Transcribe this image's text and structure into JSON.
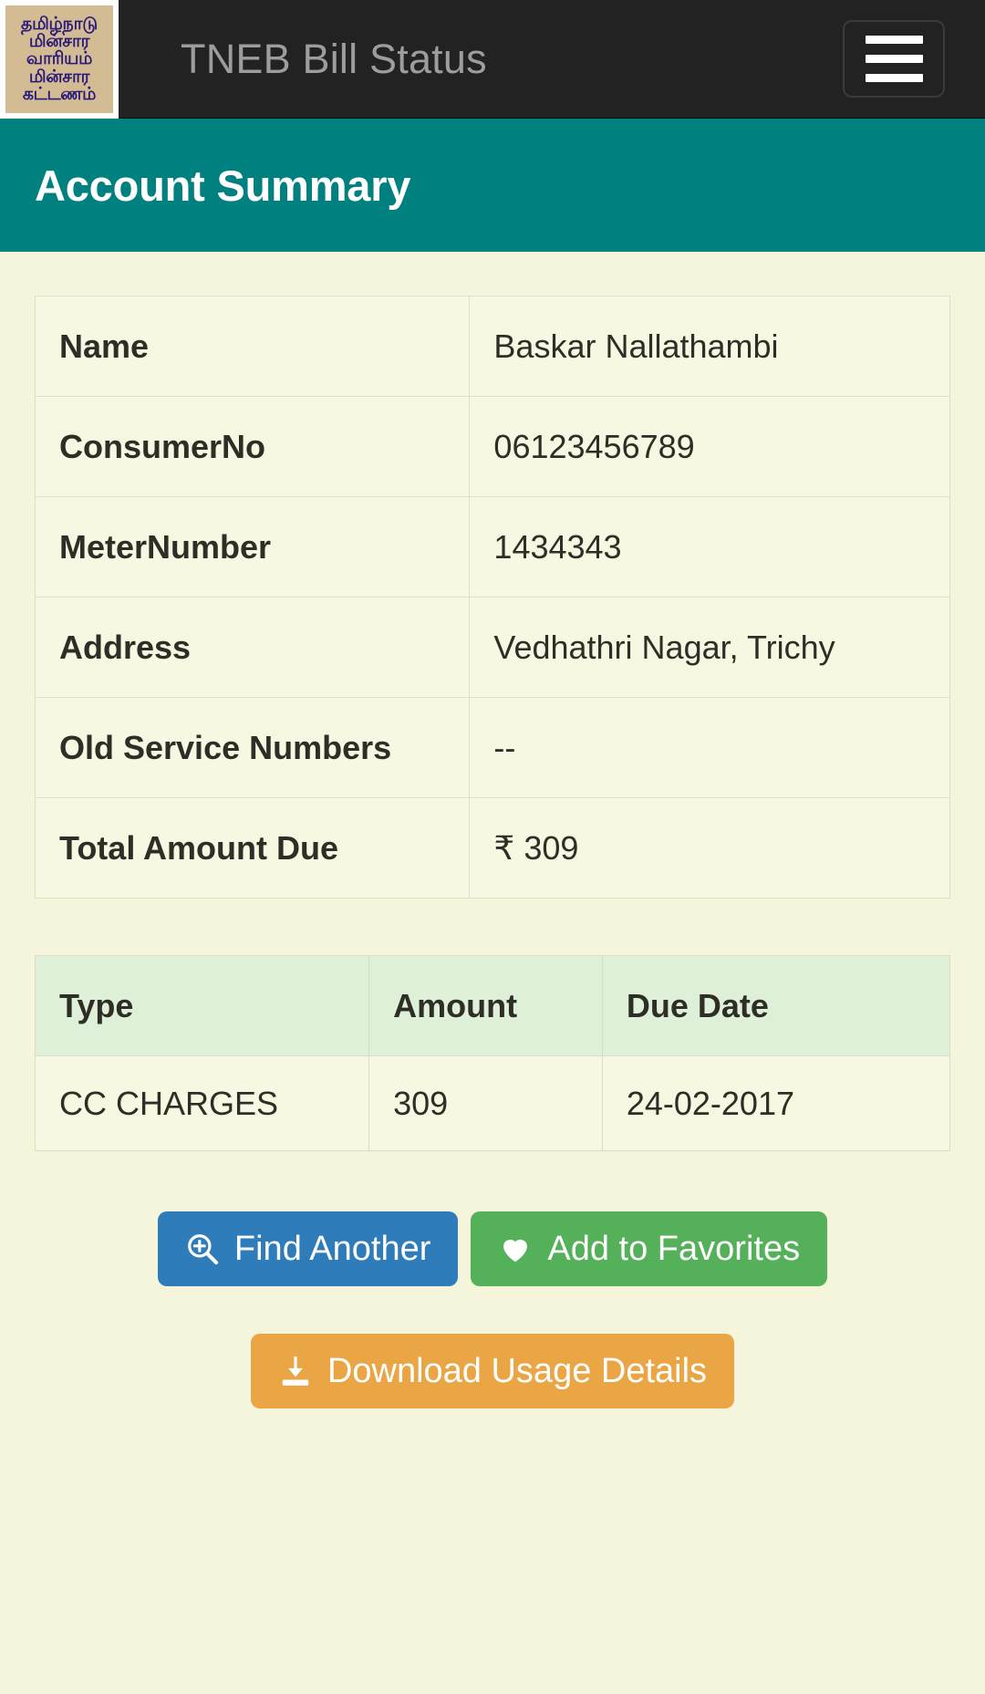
{
  "navbar": {
    "title": "TNEB Bill Status",
    "logo_lines": [
      "தமிழ்நாடு",
      "மின்சார",
      "வாரியம்",
      "மின்சார",
      "கட்டணம்"
    ],
    "menu_label": "menu"
  },
  "page_header": {
    "title": "Account Summary"
  },
  "summary": {
    "rows": [
      {
        "label": "Name",
        "value": "Baskar Nallathambi"
      },
      {
        "label": "ConsumerNo",
        "value": "06123456789"
      },
      {
        "label": "MeterNumber",
        "value": "1434343"
      },
      {
        "label": "Address",
        "value": "Vedhathri Nagar, Trichy"
      },
      {
        "label": "Old Service Numbers",
        "value": "--"
      },
      {
        "label": "Total Amount Due",
        "value": "₹ 309"
      }
    ]
  },
  "charges": {
    "headers": {
      "type": "Type",
      "amount": "Amount",
      "due_date": "Due Date"
    },
    "rows": [
      {
        "type": "CC CHARGES",
        "amount": "309",
        "due_date": "24-02-2017"
      }
    ]
  },
  "actions": {
    "find_another": "Find Another",
    "add_to_favorites": "Add to Favorites",
    "download_usage": "Download Usage Details"
  },
  "colors": {
    "navbar_bg": "#222222",
    "navbar_text": "#9d9d9d",
    "header_teal": "#00807f",
    "page_bg": "#f5f5dc",
    "table_cell_bg": "#f7f7e2",
    "charges_header_bg": "#dff0d8",
    "btn_blue": "#2e7cba",
    "btn_green": "#55b05a",
    "btn_orange": "#eaa545",
    "logo_bg": "#d3bb94",
    "logo_text": "#2a1a78"
  }
}
